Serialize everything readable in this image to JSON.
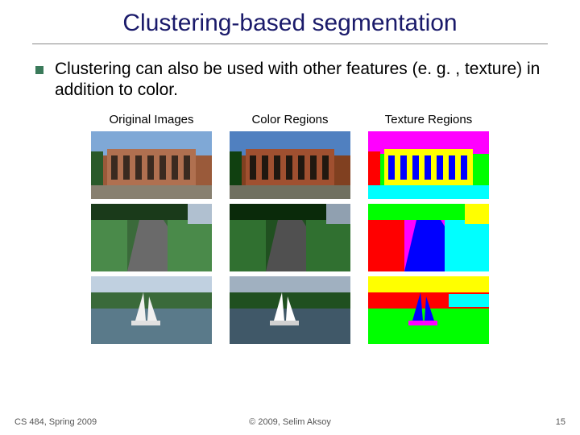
{
  "title": "Clustering-based segmentation",
  "body": "Clustering can also be used with other features (e. g. , texture) in addition to color.",
  "columns": [
    "Original Images",
    "Color Regions",
    "Texture Regions"
  ],
  "footer": {
    "left": "CS 484, Spring 2009",
    "center": "© 2009, Selim Aksoy",
    "right": "15"
  }
}
